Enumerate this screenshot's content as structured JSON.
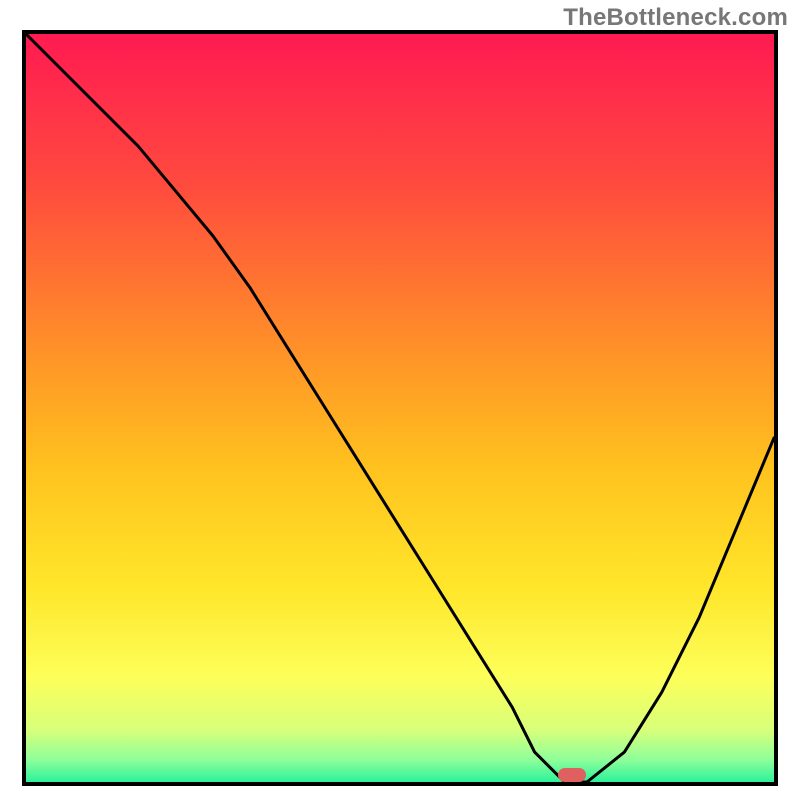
{
  "watermark": "TheBottleneck.com",
  "colors": {
    "frame": "#000000",
    "curve": "#000000",
    "marker": "#e06060",
    "gradient_stops": [
      {
        "offset": 0.0,
        "color": "#ff1a52"
      },
      {
        "offset": 0.2,
        "color": "#ff4a3e"
      },
      {
        "offset": 0.4,
        "color": "#ff8a2a"
      },
      {
        "offset": 0.58,
        "color": "#ffc21e"
      },
      {
        "offset": 0.74,
        "color": "#ffe62a"
      },
      {
        "offset": 0.86,
        "color": "#fdff5a"
      },
      {
        "offset": 0.93,
        "color": "#d8ff7a"
      },
      {
        "offset": 0.97,
        "color": "#8fff9a"
      },
      {
        "offset": 1.0,
        "color": "#2cf29a"
      }
    ]
  },
  "chart_data": {
    "type": "line",
    "title": "",
    "xlabel": "",
    "ylabel": "",
    "xlim": [
      0,
      100
    ],
    "ylim": [
      0,
      100
    ],
    "x": [
      0,
      5,
      10,
      15,
      20,
      25,
      30,
      35,
      40,
      45,
      50,
      55,
      60,
      65,
      68,
      72,
      75,
      80,
      85,
      90,
      95,
      100
    ],
    "values": [
      100,
      95,
      90,
      85,
      79,
      73,
      66,
      58,
      50,
      42,
      34,
      26,
      18,
      10,
      4,
      0,
      0,
      4,
      12,
      22,
      34,
      46
    ],
    "marker": {
      "x": 73,
      "y": 1
    },
    "note": "x is relative horizontal position (0=left,100=right); y is bottleneck % (0=bottom green, 100=top red). Curve is the black bottleneck line; marker is the pink lozenge at the minimum."
  }
}
